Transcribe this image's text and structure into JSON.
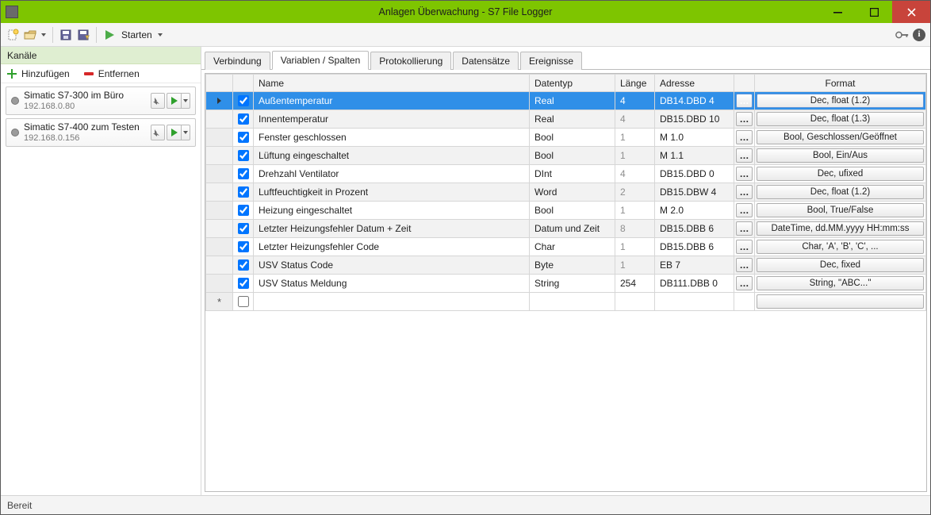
{
  "window": {
    "title": "Anlagen Überwachung - S7 File Logger"
  },
  "toolbar": {
    "start_label": "Starten"
  },
  "sidebar": {
    "title": "Kanäle",
    "add_label": "Hinzufügen",
    "remove_label": "Entfernen",
    "channels": [
      {
        "name": "Simatic S7-300 im Büro",
        "ip": "192.168.0.80"
      },
      {
        "name": "Simatic S7-400 zum Testen",
        "ip": "192.168.0.156"
      }
    ]
  },
  "tabs": {
    "items": [
      "Verbindung",
      "Variablen / Spalten",
      "Protokollierung",
      "Datensätze",
      "Ereignisse"
    ],
    "active": 1
  },
  "grid": {
    "headers": {
      "name": "Name",
      "datentyp": "Datentyp",
      "laenge": "Länge",
      "adresse": "Adresse",
      "format": "Format"
    },
    "rows": [
      {
        "checked": true,
        "name": "Außentemperatur",
        "type": "Real",
        "len": "4",
        "addr": "DB14.DBD 4",
        "format": "Dec, float (1.2)",
        "selected": true
      },
      {
        "checked": true,
        "name": "Innentemperatur",
        "type": "Real",
        "len": "4",
        "addr": "DB15.DBD 10",
        "format": "Dec, float (1.3)"
      },
      {
        "checked": true,
        "name": "Fenster geschlossen",
        "type": "Bool",
        "len": "1",
        "addr": "M 1.0",
        "format": "Bool, Geschlossen/Geöffnet"
      },
      {
        "checked": true,
        "name": "Lüftung eingeschaltet",
        "type": "Bool",
        "len": "1",
        "addr": "M 1.1",
        "format": "Bool, Ein/Aus"
      },
      {
        "checked": true,
        "name": "Drehzahl Ventilator",
        "type": "DInt",
        "len": "4",
        "addr": "DB15.DBD 0",
        "format": "Dec, ufixed"
      },
      {
        "checked": true,
        "name": "Luftfeuchtigkeit in Prozent",
        "type": "Word",
        "len": "2",
        "addr": "DB15.DBW 4",
        "format": "Dec, float (1.2)"
      },
      {
        "checked": true,
        "name": "Heizung eingeschaltet",
        "type": "Bool",
        "len": "1",
        "addr": "M 2.0",
        "format": "Bool, True/False"
      },
      {
        "checked": true,
        "name": "Letzter Heizungsfehler Datum + Zeit",
        "type": "Datum und Zeit",
        "len": "8",
        "addr": "DB15.DBB 6",
        "format": "DateTime, dd.MM.yyyy HH:mm:ss"
      },
      {
        "checked": true,
        "name": "Letzter Heizungsfehler Code",
        "type": "Char",
        "len": "1",
        "addr": "DB15.DBB 6",
        "format": "Char, 'A', 'B', 'C', ..."
      },
      {
        "checked": true,
        "name": "USV Status Code",
        "type": "Byte",
        "len": "1",
        "addr": "EB 7",
        "format": "Dec, fixed"
      },
      {
        "checked": true,
        "name": "USV Status Meldung",
        "type": "String",
        "len": "254",
        "addr": "DB111.DBB 0",
        "format": "String, \"ABC...\""
      }
    ]
  },
  "status": {
    "text": "Bereit"
  }
}
